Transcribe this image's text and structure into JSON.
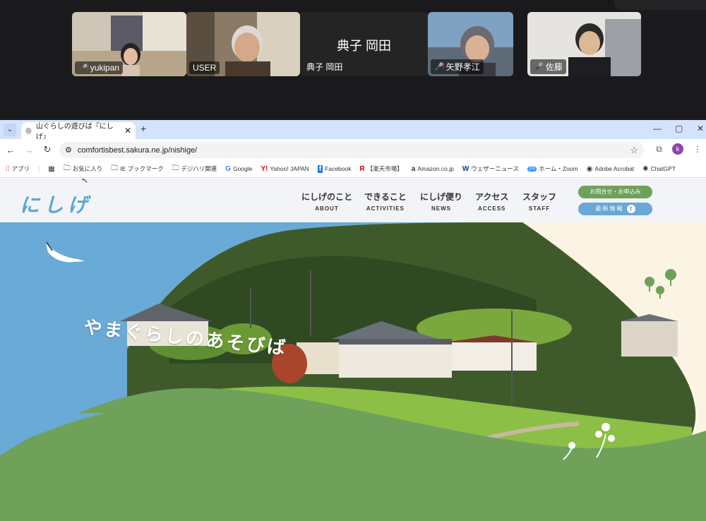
{
  "conference": {
    "participants": [
      {
        "name": "yukipan",
        "muted": true
      },
      {
        "name": "USER",
        "muted": false
      },
      {
        "name": "典子 岡田",
        "muted": false,
        "display_name": "典子 岡田"
      },
      {
        "name": "矢野孝江",
        "muted": true
      },
      {
        "name": "佐藤",
        "muted": true
      }
    ]
  },
  "browser": {
    "tab_title": "山ぐらしの遊びば『にしげ』",
    "url": "comfortisbest.sakura.ne.jp/nishige/",
    "avatar_letter": "k",
    "bookmarks": [
      {
        "label": "アプリ",
        "icon": "apps-icon"
      },
      {
        "label": "お気に入り",
        "icon": "folder-icon"
      },
      {
        "label": "IE ブックマーク",
        "icon": "folder-icon"
      },
      {
        "label": "デジハリ関連",
        "icon": "folder-icon"
      },
      {
        "label": "Google",
        "icon": "google-icon"
      },
      {
        "label": "Yahoo! JAPAN",
        "icon": "yahoo-icon"
      },
      {
        "label": "Facebook",
        "icon": "facebook-icon"
      },
      {
        "label": "【楽天市場】",
        "icon": "rakuten-icon"
      },
      {
        "label": "Amazon.co.jp",
        "icon": "amazon-icon"
      },
      {
        "label": "ウェザーニュース",
        "icon": "weather-icon"
      },
      {
        "label": "ホーム・Zoom",
        "icon": "zoom-icon"
      },
      {
        "label": "Adobe Acrobat",
        "icon": "acrobat-icon"
      },
      {
        "label": "ChatGPT",
        "icon": "chatgpt-icon"
      }
    ]
  },
  "site": {
    "logo": "にしげ",
    "menu": [
      {
        "jp": "にしげのこと",
        "en": "ABOUT"
      },
      {
        "jp": "できること",
        "en": "ACTIVITIES"
      },
      {
        "jp": "にしげ便り",
        "en": "NEWS"
      },
      {
        "jp": "アクセス",
        "en": "ACCESS"
      },
      {
        "jp": "スタッフ",
        "en": "STAFF"
      }
    ],
    "contact_label": "お問合せ・お申込み",
    "news_label": "最新情報",
    "tagline": "やまぐらしのあそびば",
    "colors": {
      "sky": "#6aaad6",
      "green": "#6fa15a",
      "cream": "#fbf3e3",
      "accent_blue": "#5fa6d4"
    }
  }
}
